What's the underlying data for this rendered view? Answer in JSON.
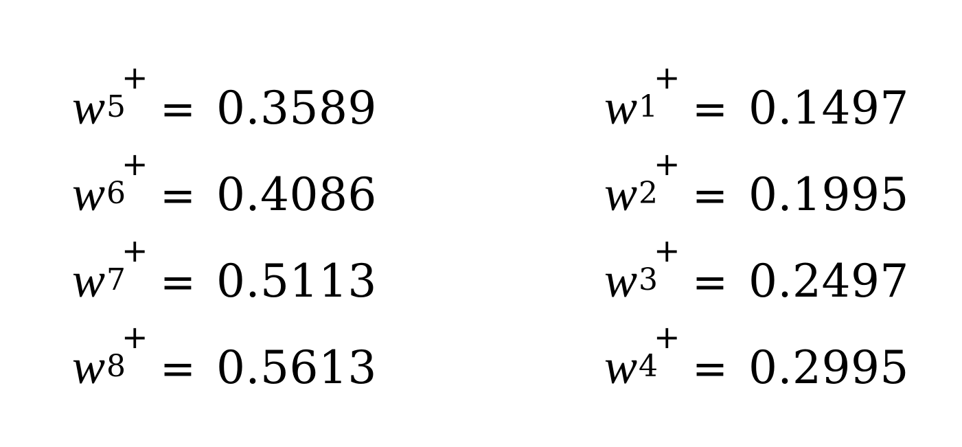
{
  "equations": {
    "left": [
      {
        "symbol": "w",
        "subscript": "5",
        "superscript": "+",
        "operator": "=",
        "value": "0.3589"
      },
      {
        "symbol": "w",
        "subscript": "6",
        "superscript": "+",
        "operator": "=",
        "value": "0.4086"
      },
      {
        "symbol": "w",
        "subscript": "7",
        "superscript": "+",
        "operator": "=",
        "value": "0.5113"
      },
      {
        "symbol": "w",
        "subscript": "8",
        "superscript": "+",
        "operator": "=",
        "value": "0.5613"
      }
    ],
    "right": [
      {
        "symbol": "w",
        "subscript": "1",
        "superscript": "+",
        "operator": "=",
        "value": "0.1497"
      },
      {
        "symbol": "w",
        "subscript": "2",
        "superscript": "+",
        "operator": "=",
        "value": "0.1995"
      },
      {
        "symbol": "w",
        "subscript": "3",
        "superscript": "+",
        "operator": "=",
        "value": "0.2497"
      },
      {
        "symbol": "w",
        "subscript": "4",
        "superscript": "+",
        "operator": "=",
        "value": "0.2995"
      }
    ]
  }
}
